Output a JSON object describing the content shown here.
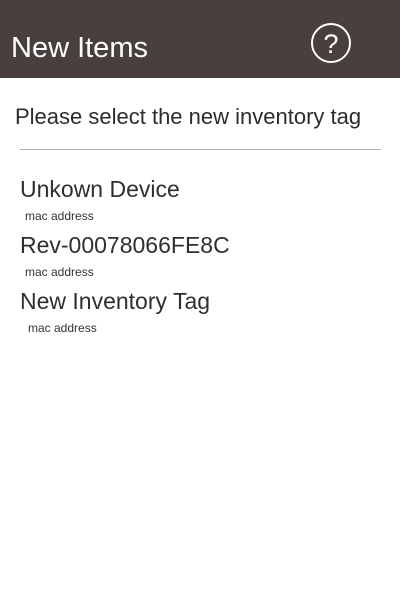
{
  "header": {
    "title": "New Items",
    "help_icon": "help-circle-icon",
    "help_symbol": "?"
  },
  "content": {
    "instruction": "Please select the new inventory tag"
  },
  "devices": [
    {
      "name": "Unkown Device",
      "subtitle": "mac address"
    },
    {
      "name": "Rev-00078066FE8C",
      "subtitle": "mac address"
    },
    {
      "name": "New Inventory Tag",
      "subtitle": "mac address"
    }
  ],
  "colors": {
    "header_background": "#483f3e",
    "header_text": "#ffffff",
    "divider": "#b3b3b3"
  }
}
